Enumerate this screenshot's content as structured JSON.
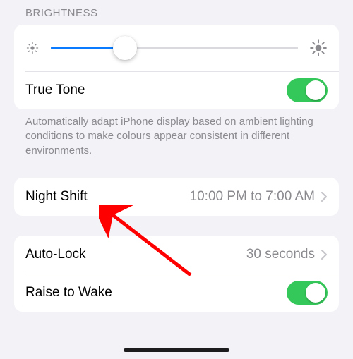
{
  "section_header": "BRIGHTNESS",
  "icons": {
    "sun_small": "sun-low-icon",
    "sun_large": "sun-high-icon",
    "chevron": "chevron-right-icon"
  },
  "brightness": {
    "value_percent": 30
  },
  "true_tone": {
    "label": "True Tone",
    "enabled": true,
    "note": "Automatically adapt iPhone display based on ambient lighting conditions to make colours appear consistent in different environments."
  },
  "night_shift": {
    "label": "Night Shift",
    "value": "10:00 PM to 7:00 AM"
  },
  "auto_lock": {
    "label": "Auto-Lock",
    "value": "30 seconds"
  },
  "raise_to_wake": {
    "label": "Raise to Wake",
    "enabled": true
  },
  "colors": {
    "switch_on": "#34c759",
    "accent": "#0a7bff",
    "annotation_arrow": "#ff0000"
  }
}
